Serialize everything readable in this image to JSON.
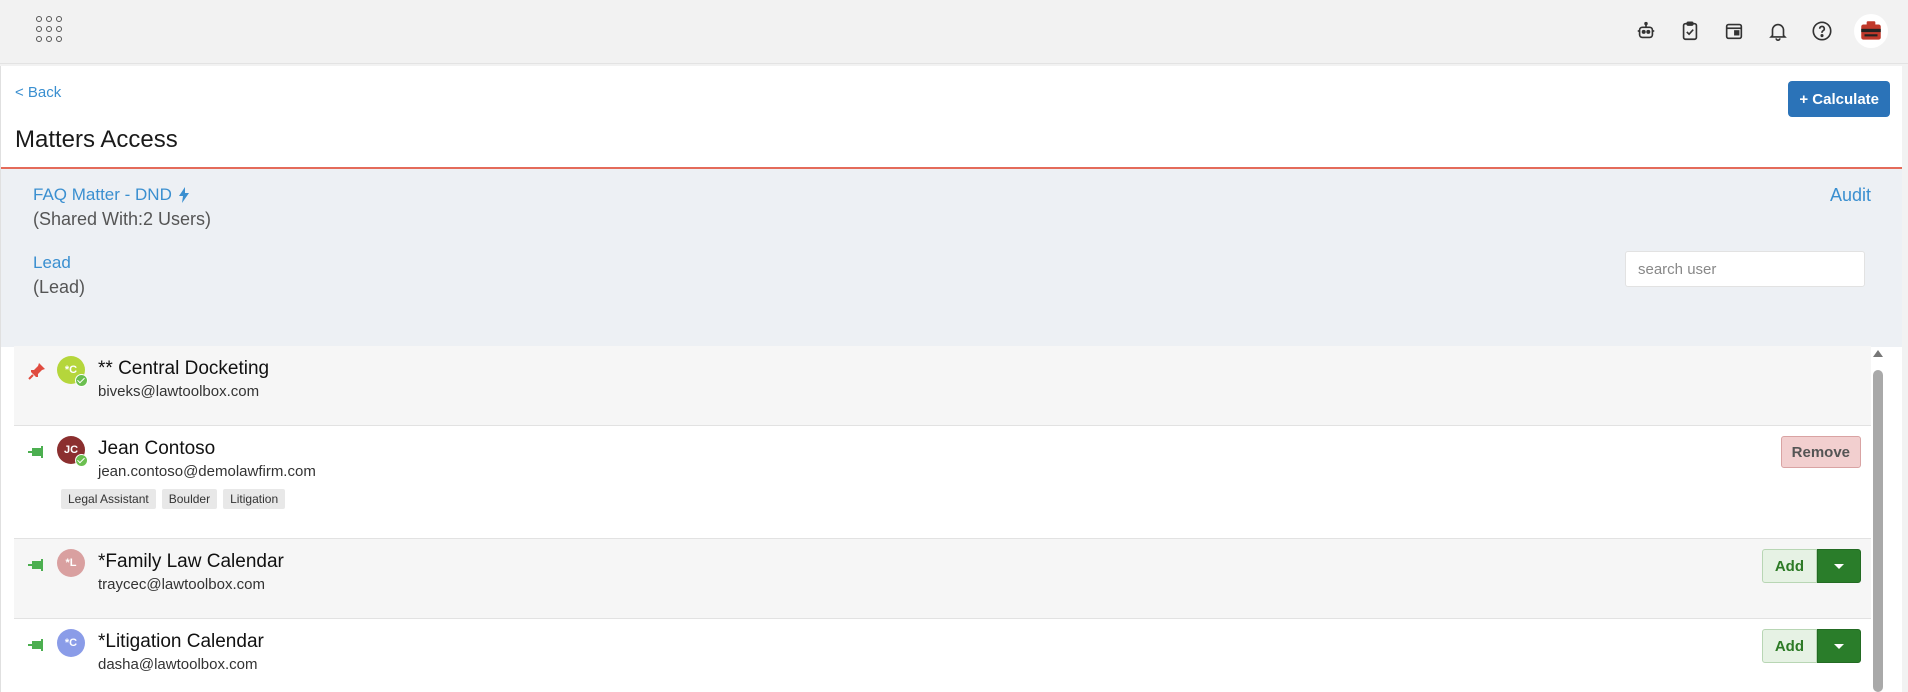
{
  "topbar": {
    "icons": [
      "apps-grid-icon",
      "robot-icon",
      "clipboard-check-icon",
      "calendar-icon",
      "bell-icon",
      "help-icon"
    ],
    "avatar": "user-avatar"
  },
  "header": {
    "back_label": "< Back",
    "calculate_label": "+ Calculate",
    "title": "Matters Access"
  },
  "matter": {
    "name": "FAQ Matter - DND",
    "shared": "(Shared With:2 Users)",
    "audit_label": "Audit",
    "lead_label": "Lead",
    "lead_sub": "(Lead)"
  },
  "search": {
    "placeholder": "search user"
  },
  "colors": {
    "accent": "#3a8fd0",
    "calculate": "#2b73b8",
    "title_rule": "#e46b5a",
    "add_dark": "#2a7d2a",
    "remove_bg": "#f2cfcf"
  },
  "users": [
    {
      "initials": "*C",
      "name": "** Central Docketing",
      "email": "biveks@lawtoolbox.com",
      "pin": "pinned",
      "avatar_color": "#b5d63b",
      "verified": true,
      "tags": [],
      "action": ""
    },
    {
      "initials": "JC",
      "name": "Jean Contoso",
      "email": "jean.contoso@demolawfirm.com",
      "pin": "unpinned",
      "avatar_color": "#8b2f2f",
      "verified": true,
      "tags": [
        "Legal Assistant",
        "Boulder",
        "Litigation"
      ],
      "action": "Remove"
    },
    {
      "initials": "*L",
      "name": "*Family Law Calendar",
      "email": "traycec@lawtoolbox.com",
      "pin": "unpinned",
      "avatar_color": "#d9a0a0",
      "verified": false,
      "tags": [],
      "action": "Add"
    },
    {
      "initials": "*C",
      "name": "*Litigation Calendar",
      "email": "dasha@lawtoolbox.com",
      "pin": "unpinned",
      "avatar_color": "#8a9ce8",
      "verified": false,
      "tags": [],
      "action": "Add"
    }
  ]
}
